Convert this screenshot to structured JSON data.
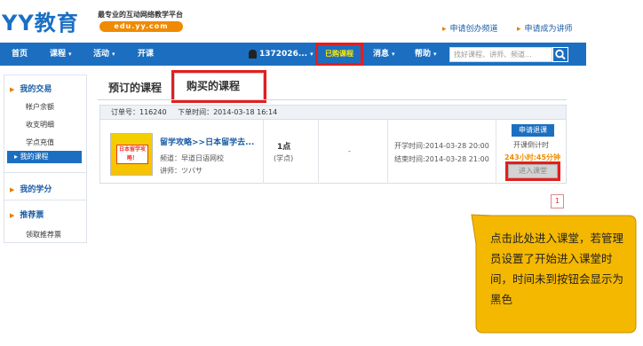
{
  "header": {
    "logo_text": "YY教育",
    "slogan": "最专业的互动网络教学平台",
    "domain": "edu.yy.com",
    "link_apply_channel": "申请创办频道",
    "link_apply_teacher": "申请成为讲师"
  },
  "nav": {
    "home": "首页",
    "courses": "课程",
    "activities": "活动",
    "open_class": "开课",
    "user": "1372026...",
    "purchased": "已购课程",
    "messages": "消息",
    "help": "帮助",
    "search_placeholder": "找好课程、讲师、频道..."
  },
  "sidebar": {
    "my_trades": "我的交易",
    "items": [
      "帐户余额",
      "收支明细",
      "学点充值",
      "我的课程"
    ],
    "my_credits": "我的学分",
    "recommend": "推荐票",
    "get_ticket": "领取推荐票"
  },
  "tabs": {
    "reserved": "预订的课程",
    "bought": "购买的课程"
  },
  "order": {
    "number": "订单号：116240",
    "time": "下单时间：2014-03-18 16:14",
    "course_title": "留学攻略>>日本留学去...",
    "channel": "频道：早道日语网校",
    "teacher": "讲师：ツバサ",
    "thumb_text": "日本留学攻略！",
    "price": "1点",
    "price_unit": "(学点)",
    "dash": "-",
    "start_time": "开学时间:2014-03-28 20:00",
    "end_time": "结束时间:2014-03-28 21:00",
    "refund_button": "申请退课",
    "countdown_label": "开课倒计时",
    "countdown": "243小时:45分钟",
    "enter_button": "进入课堂",
    "page": "1"
  },
  "callout": {
    "text": "点击此处进入课堂，若管理员设置了开始进入课堂时间，时间未到按钮会显示为黑色"
  },
  "colors": {
    "brand_blue": "#1c6fc0",
    "accent_orange": "#f08a00",
    "highlight_red": "#e41e1e",
    "callout_yellow": "#f5b800"
  }
}
